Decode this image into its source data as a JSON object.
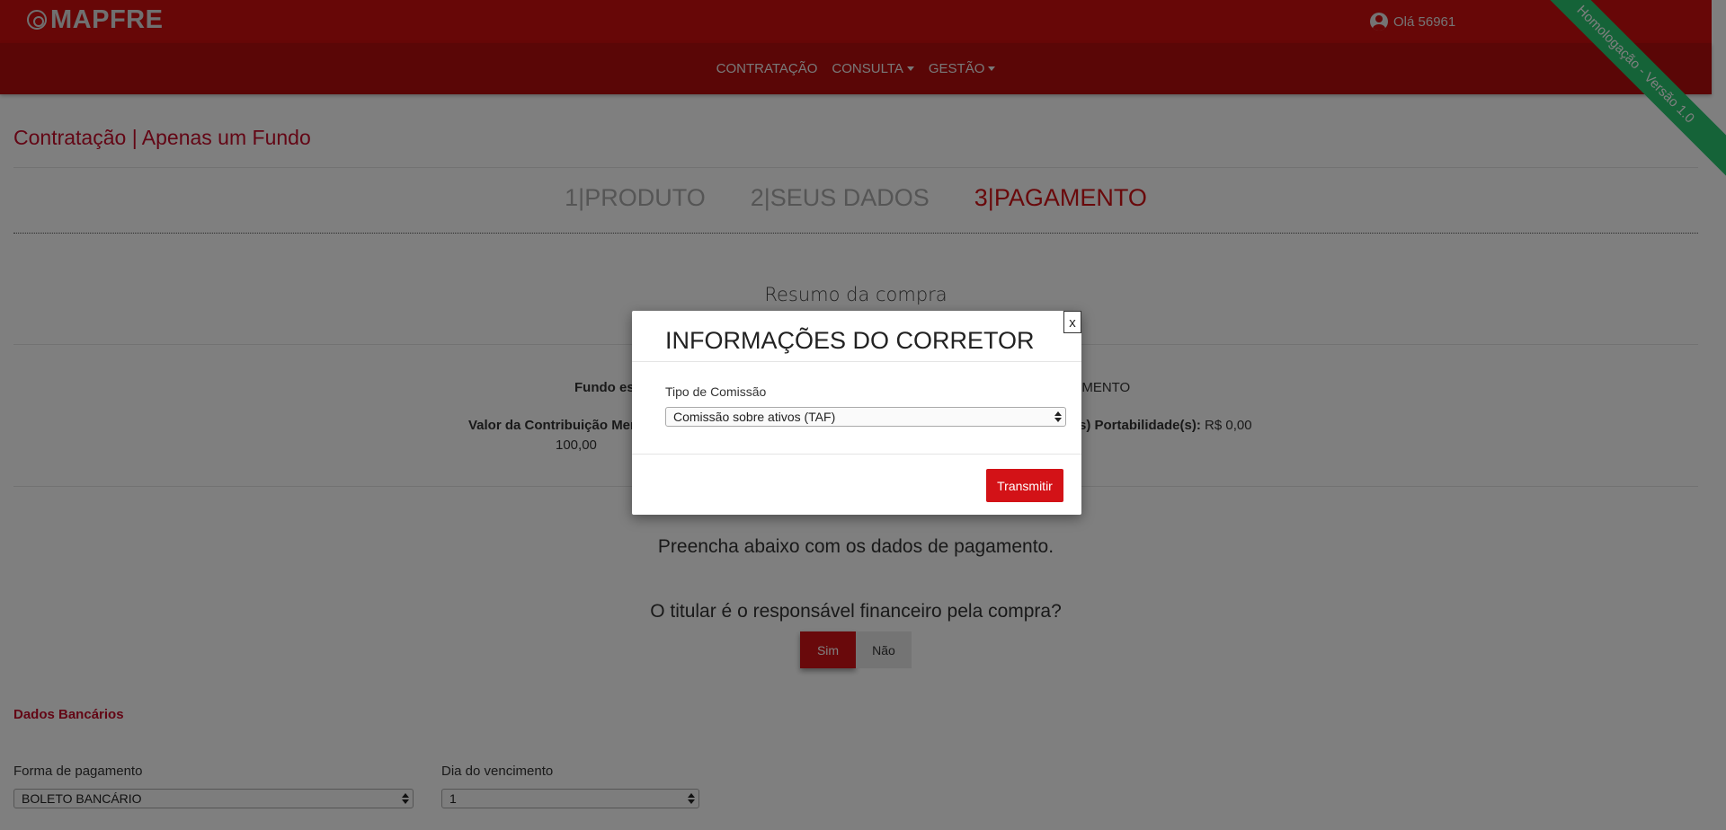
{
  "header": {
    "logo_text": "MAPFRE",
    "user_greeting": "Olá 56961",
    "ribbon": "Homologação - Versão 1.0"
  },
  "nav": {
    "items": [
      {
        "label": "CONTRATAÇÃO"
      },
      {
        "label": "CONSULTA"
      },
      {
        "label": "GESTÃO"
      }
    ]
  },
  "page": {
    "title": "Contratação | Apenas um Fundo",
    "steps": [
      {
        "num": "1|",
        "label": "PRODUTO"
      },
      {
        "num": "2|",
        "label": "SEUS DADOS"
      },
      {
        "num": "3|",
        "label": "PAGAMENTO"
      }
    ],
    "resumo_title": "Resumo da compra",
    "fundo_label": "Fundo es",
    "fundo_value_fragment": "TIMENTO",
    "contrib_label": "Valor da Contribuição Men",
    "contrib_value": "100,00",
    "portabilidade_label": "s) Portabilidade(s):",
    "portabilidade_value": "R$ 0,00",
    "preencha": "Preencha abaixo com os dados de pagamento.",
    "titular_question": "O titular é o responsável financeiro pela compra?",
    "toggle_yes": "Sim",
    "toggle_no": "Não",
    "dados_bancarios": "Dados Bancários",
    "forma_label": "Forma de pagamento",
    "forma_value": "BOLETO BANCÁRIO",
    "dia_label": "Dia do vencimento",
    "dia_value": "1"
  },
  "modal": {
    "title": "INFORMAÇÕES DO CORRETOR",
    "close": "x",
    "field_label": "Tipo de Comissão",
    "field_value": "Comissão sobre ativos (TAF)",
    "submit": "Transmitir"
  },
  "colors": {
    "brand_red": "#ce0e0e",
    "nav_red": "#b50d0d",
    "accent_red": "#d31217",
    "ribbon_green": "#2bc770"
  }
}
